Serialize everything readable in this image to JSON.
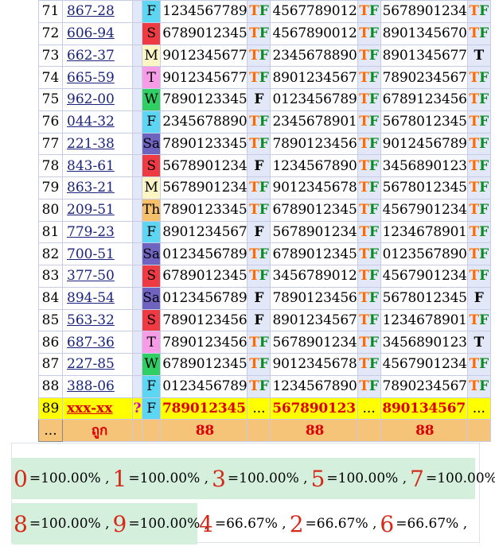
{
  "rows": [
    {
      "no": "71",
      "code": "867-28",
      "day": "F",
      "n1": "1234567789",
      "t1": "TF",
      "n2": "4567789012",
      "t2": "TF",
      "n3": "5678901234",
      "t3": "TF"
    },
    {
      "no": "72",
      "code": "606-94",
      "day": "S",
      "n1": "6789012345",
      "t1": "TF",
      "n2": "4567890012",
      "t2": "TF",
      "n3": "8901345670",
      "t3": "TF"
    },
    {
      "no": "73",
      "code": "662-37",
      "day": "M",
      "n1": "9012345677",
      "t1": "TF",
      "n2": "2345678890",
      "t2": "TF",
      "n3": "8901345677",
      "t3": "T"
    },
    {
      "no": "74",
      "code": "665-59",
      "day": "T",
      "n1": "9012345677",
      "t1": "TF",
      "n2": "8901234567",
      "t2": "TF",
      "n3": "7890234567",
      "t3": "TF"
    },
    {
      "no": "75",
      "code": "962-00",
      "day": "W",
      "n1": "7890123345",
      "t1": "F",
      "n2": "0123456789",
      "t2": "TF",
      "n3": "6789123456",
      "t3": "TF"
    },
    {
      "no": "76",
      "code": "044-32",
      "day": "F",
      "n1": "2345678890",
      "t1": "TF",
      "n2": "2345678901",
      "t2": "TF",
      "n3": "5678012345",
      "t3": "TF"
    },
    {
      "no": "77",
      "code": "221-38",
      "day": "Sa",
      "n1": "7890123345",
      "t1": "TF",
      "n2": "7890123456",
      "t2": "TF",
      "n3": "9012456789",
      "t3": "TF"
    },
    {
      "no": "78",
      "code": "843-61",
      "day": "S",
      "n1": "5678901234",
      "t1": "F",
      "n2": "1234567890",
      "t2": "TF",
      "n3": "3456890123",
      "t3": "TF"
    },
    {
      "no": "79",
      "code": "863-21",
      "day": "M",
      "n1": "5678901234",
      "t1": "TF",
      "n2": "9012345678",
      "t2": "TF",
      "n3": "5678012345",
      "t3": "TF"
    },
    {
      "no": "80",
      "code": "209-51",
      "day": "Th",
      "n1": "7890123345",
      "t1": "TF",
      "n2": "6789012345",
      "t2": "TF",
      "n3": "4567901234",
      "t3": "TF"
    },
    {
      "no": "81",
      "code": "779-23",
      "day": "F",
      "n1": "8901234567",
      "t1": "F",
      "n2": "5678901234",
      "t2": "TF",
      "n3": "1234678901",
      "t3": "TF"
    },
    {
      "no": "82",
      "code": "700-51",
      "day": "Sa",
      "n1": "0123456789",
      "t1": "TF",
      "n2": "6789012345",
      "t2": "TF",
      "n3": "0123567890",
      "t3": "TF"
    },
    {
      "no": "83",
      "code": "377-50",
      "day": "S",
      "n1": "6789012345",
      "t1": "TF",
      "n2": "3456789012",
      "t2": "TF",
      "n3": "4567901234",
      "t3": "TF"
    },
    {
      "no": "84",
      "code": "894-54",
      "day": "Sa",
      "n1": "0123456789",
      "t1": "F",
      "n2": "7890123456",
      "t2": "TF",
      "n3": "5678012345",
      "t3": "F"
    },
    {
      "no": "85",
      "code": "563-32",
      "day": "S",
      "n1": "7890123456",
      "t1": "F",
      "n2": "8901234567",
      "t2": "TF",
      "n3": "1234678901",
      "t3": "TF"
    },
    {
      "no": "86",
      "code": "687-36",
      "day": "T",
      "n1": "7890123456",
      "t1": "TF",
      "n2": "5678901234",
      "t2": "TF",
      "n3": "3456890123",
      "t3": "T"
    },
    {
      "no": "87",
      "code": "227-85",
      "day": "W",
      "n1": "6789012345",
      "t1": "TF",
      "n2": "9012345678",
      "t2": "TF",
      "n3": "4567901234",
      "t3": "TF"
    },
    {
      "no": "88",
      "code": "388-06",
      "day": "F",
      "n1": "0123456789",
      "t1": "TF",
      "n2": "1234567890",
      "t2": "TF",
      "n3": "7890234567",
      "t3": "TF"
    }
  ],
  "prediction": {
    "no": "89",
    "code": "xxx-xx",
    "mark": "?",
    "day": "F",
    "n1": "789012345",
    "g1": "...",
    "n2": "567890123",
    "g2": "...",
    "n3": "890134567",
    "g3": "..."
  },
  "counts": {
    "no": "...",
    "label": "ถูก",
    "c1": "88",
    "c2": "88",
    "c3": "88"
  },
  "stats_line1": [
    {
      "digit": "0",
      "pct": "=100.00% ,"
    },
    {
      "digit": "1",
      "pct": "=100.00% ,"
    },
    {
      "digit": "3",
      "pct": "=100.00% ,"
    },
    {
      "digit": "5",
      "pct": "=100.00% ,"
    },
    {
      "digit": "7",
      "pct": "=100.00% ,"
    }
  ],
  "stats_line2a": [
    {
      "digit": "8",
      "pct": "=100.00% ,"
    },
    {
      "digit": "9",
      "pct": "=100.00% ,"
    }
  ],
  "stats_line2b": [
    {
      "digit": "4",
      "pct": "=66.67% ,"
    },
    {
      "digit": "2",
      "pct": "=66.67% ,"
    },
    {
      "digit": "6",
      "pct": "=66.67% ,"
    }
  ],
  "colors": {
    "hit_orange": "#f06a00",
    "hit_green": "#0a9a3a",
    "row_highlight": "#ffff00",
    "count_row": "#f6c479",
    "stats_bg": "#d4f0dc"
  }
}
